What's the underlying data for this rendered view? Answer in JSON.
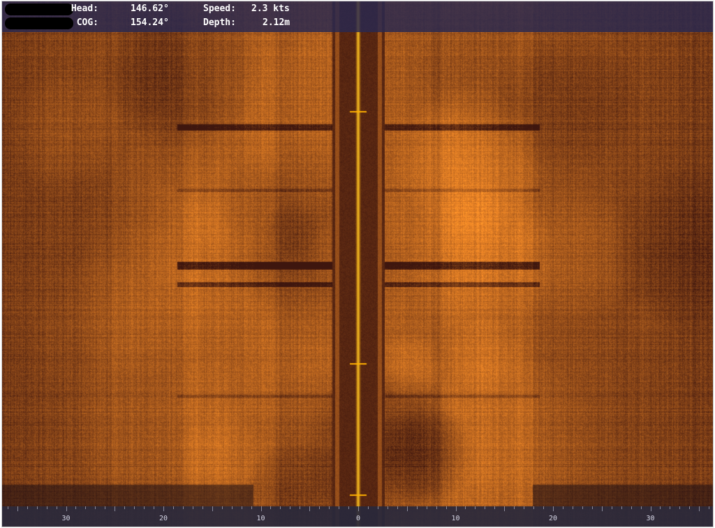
{
  "telemetry": {
    "heading_label": "Head:",
    "heading_value": "146.62°",
    "speed_label": "Speed:",
    "speed_value": "2.3 kts",
    "cog_label": "COG:",
    "cog_value": "154.24°",
    "depth_label": "Depth:",
    "depth_value": "2.12m"
  },
  "range_scale": {
    "labels": [
      "30",
      "20",
      "10",
      "0",
      "10",
      "20",
      "30"
    ],
    "values": [
      -30,
      -20,
      -10,
      0,
      10,
      20,
      30
    ]
  },
  "colors": {
    "sonar_background": "#4a1c12",
    "sonar_return": "#d89a28",
    "nadir_line": "#ffb000",
    "info_bar": "#28285a",
    "scale_bar": "#28283c"
  }
}
